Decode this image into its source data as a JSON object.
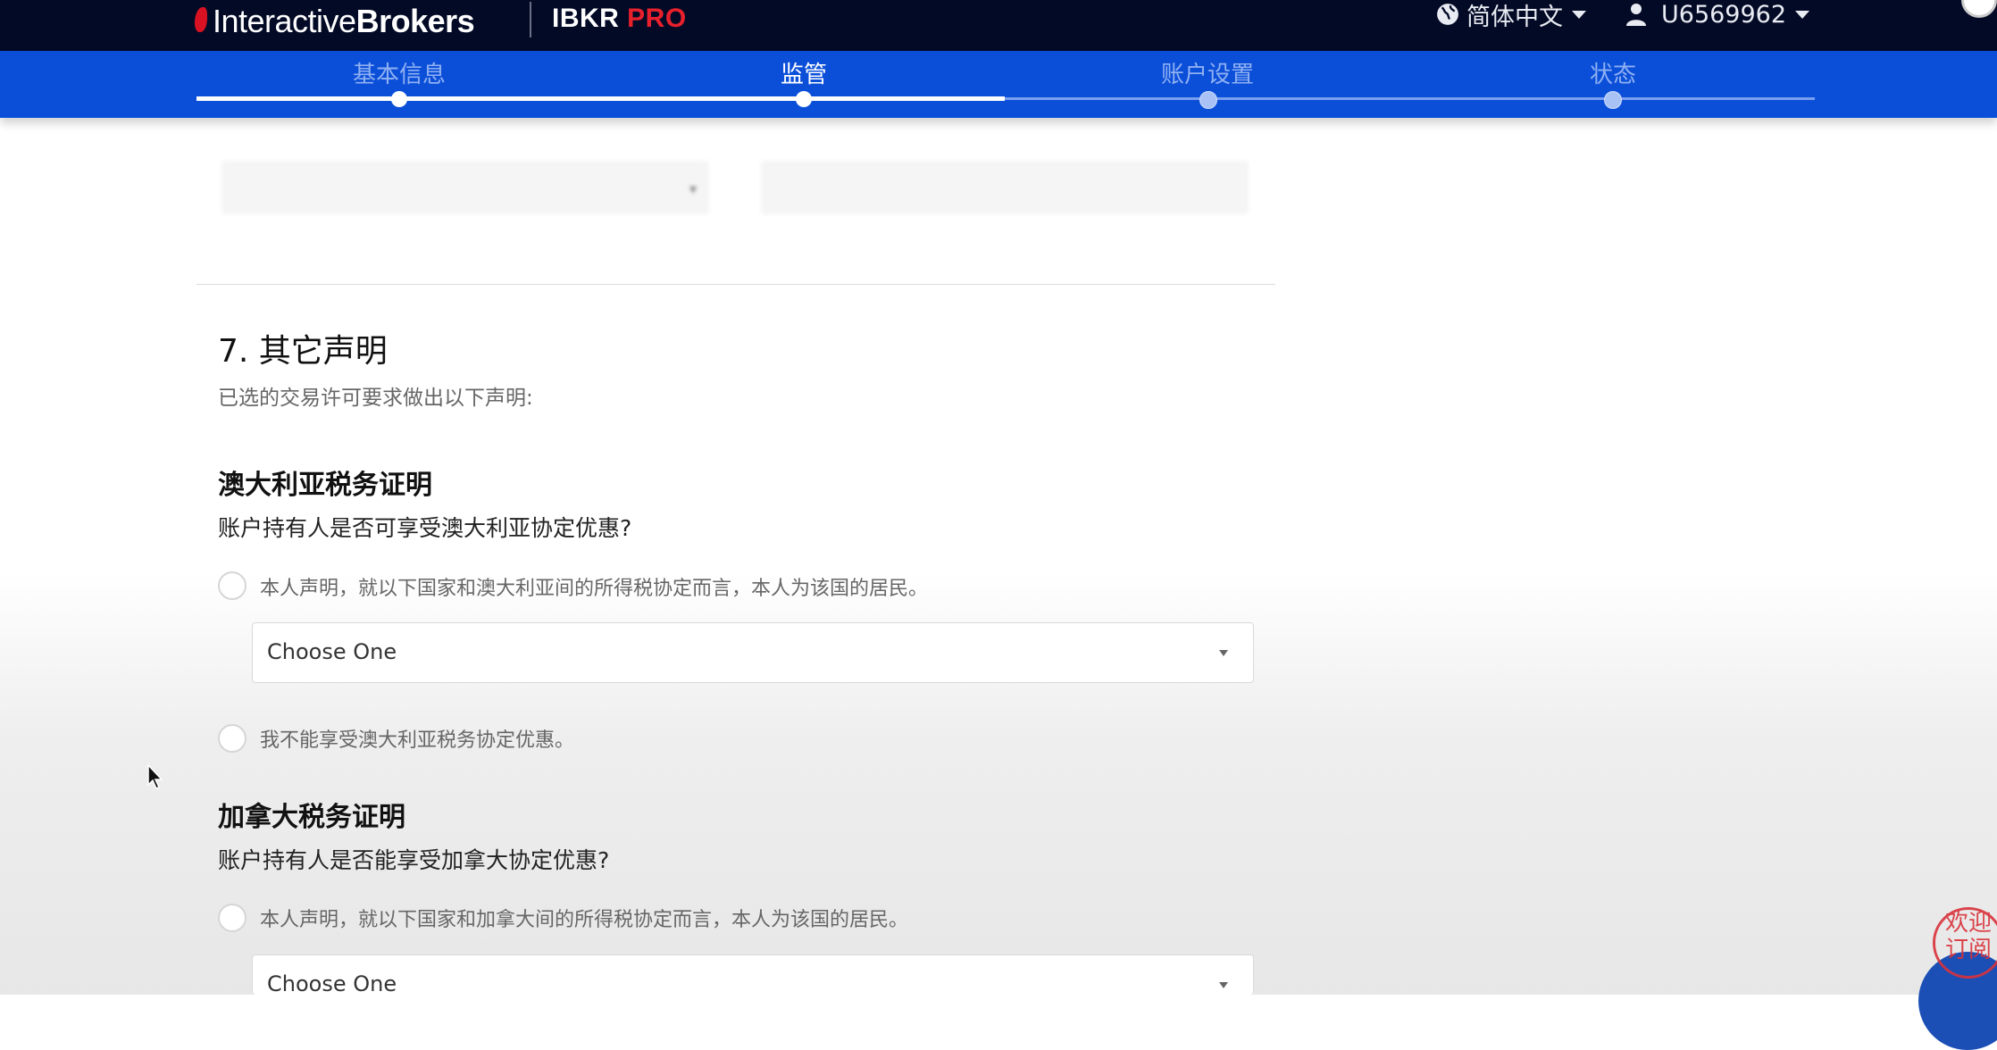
{
  "header": {
    "logo_regular": "Interactive",
    "logo_bold": "Brokers",
    "product_prefix": "IBKR ",
    "product_suffix": "PRO",
    "language": "简体中文",
    "user_id": "U6569962"
  },
  "steps": [
    {
      "label": "基本信息",
      "state": "done"
    },
    {
      "label": "监管",
      "state": "active"
    },
    {
      "label": "账户设置",
      "state": "todo"
    },
    {
      "label": "状态",
      "state": "todo"
    }
  ],
  "section": {
    "title": "7. 其它声明",
    "subtitle": "已选的交易许可要求做出以下声明:"
  },
  "australia": {
    "heading": "澳大利亚税务证明",
    "question": "账户持有人是否可享受澳大利亚协定优惠?",
    "option_resident": "本人声明，就以下国家和澳大利亚间的所得税协定而言，本人为该国的居民。",
    "select_value": "Choose One",
    "option_not_eligible": "我不能享受澳大利亚税务协定优惠。"
  },
  "canada": {
    "heading": "加拿大税务证明",
    "question": "账户持有人是否能享受加拿大协定优惠?",
    "option_resident": "本人声明，就以下国家和加拿大间的所得税协定而言，本人为该国的居民。",
    "select_value": "Choose One"
  },
  "colors": {
    "topbar": "#030a26",
    "stepbar": "#0b4fd9",
    "brand_red": "#d81222"
  },
  "icons": {
    "language": "globe-icon",
    "user": "person-icon",
    "dropdown": "caret-down-icon"
  }
}
